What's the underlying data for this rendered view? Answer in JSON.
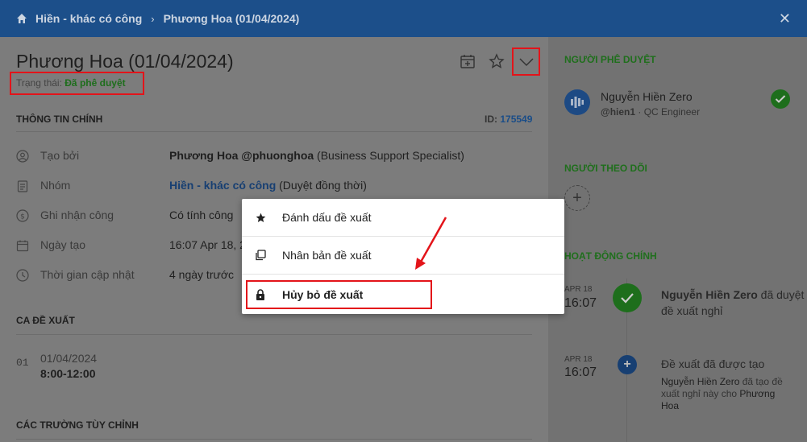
{
  "breadcrumb": {
    "group": "Hiền - khác có công",
    "item": "Phương Hoa (01/04/2024)"
  },
  "header": {
    "title": "Phương Hoa (01/04/2024)",
    "status_label": "Trạng thái:",
    "status_value": "Đã phê duyệt"
  },
  "main_info": {
    "section_title": "THÔNG TIN CHÍNH",
    "id_label": "ID:",
    "id_value": "175549",
    "rows": [
      {
        "icon": "user-icon",
        "label": "Tạo bởi",
        "value_bold": "Phương Hoa @phuonghoa",
        "value_rest": " (Business Support Specialist)"
      },
      {
        "icon": "clipboard-icon",
        "label": "Nhóm",
        "value_link": "Hiền - khác có công",
        "value_rest": " (Duyệt đồng thời)"
      },
      {
        "icon": "dollar-icon",
        "label": "Ghi nhận công",
        "value": "Có tính công"
      },
      {
        "icon": "calendar-icon",
        "label": "Ngày tạo",
        "value": "16:07 Apr 18, 2"
      },
      {
        "icon": "clock-icon",
        "label": "Thời gian cập nhật",
        "value": "4 ngày trước"
      }
    ]
  },
  "shifts": {
    "section_title": "CA ĐỀ XUẤT",
    "items": [
      {
        "index": "01",
        "date": "01/04/2024",
        "time": "8:00-12:00"
      }
    ]
  },
  "custom_fields": {
    "section_title": "CÁC TRƯỜNG TÙY CHỈNH"
  },
  "menu": {
    "items": [
      {
        "icon": "star-icon",
        "label": "Đánh dấu đề xuất"
      },
      {
        "icon": "copy-icon",
        "label": "Nhân bản đề xuất"
      },
      {
        "icon": "lock-icon",
        "label": "Hủy bỏ đề xuất"
      }
    ]
  },
  "right_panel": {
    "approvers_title": "NGƯỜI PHÊ DUYỆT",
    "approver": {
      "name": "Nguyễn Hiền Zero",
      "handle": "@hien1",
      "role": "QC Engineer"
    },
    "followers_title": "NGƯỜI THEO DÕI",
    "add_symbol": "+",
    "activity_title": "HOẠT ĐỘNG CHÍNH",
    "activities": [
      {
        "month": "APR 18",
        "time": "16:07",
        "actor": "Nguyễn Hiền Zero",
        "action": " đã duyệt đề xuất nghỉ"
      },
      {
        "month": "APR 18",
        "time": "16:07",
        "title": "Đề xuất đã được tạo",
        "actor": "Nguyễn Hiền Zero",
        "action": " đã tạo đề xuất nghỉ này cho ",
        "target": "Phương Hoa"
      }
    ]
  },
  "colors": {
    "topbar": "#1c4f8a",
    "accent_green": "#1e6e1c",
    "highlight_red": "#e3141a",
    "link_blue": "#173f72"
  }
}
